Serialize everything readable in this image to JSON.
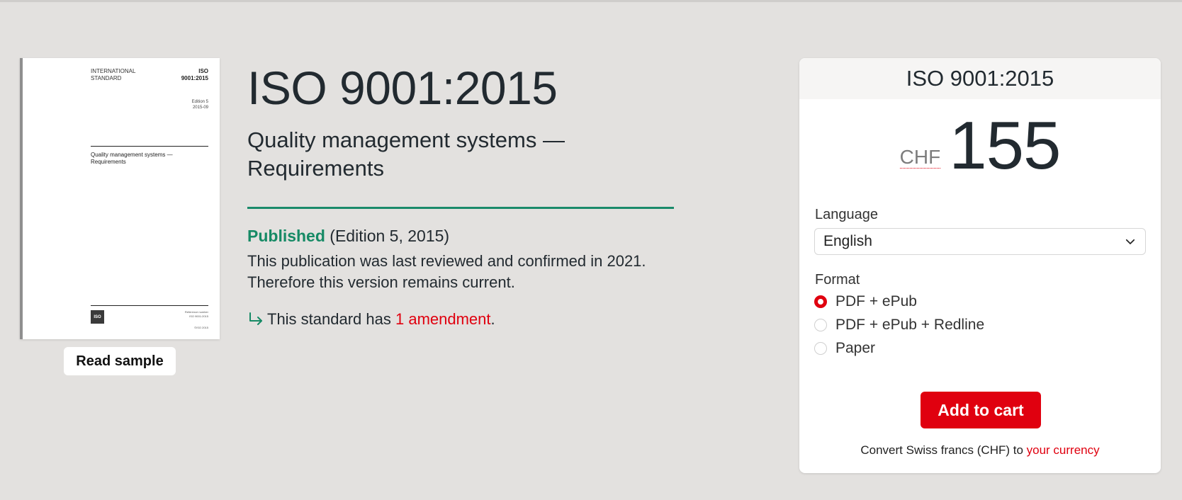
{
  "cover": {
    "intl_standard": "INTERNATIONAL STANDARD",
    "code_line1": "ISO",
    "code_line2": "9001:2015",
    "edition_line1": "Edition 5",
    "edition_line2": "2015-09",
    "title_line1": "Quality management systems —",
    "title_line2": "Requirements",
    "logo_text": "ISO",
    "ref_line1": "Reference number",
    "ref_line2": "ISO 9001:2015",
    "copyright": "©ISO 2015"
  },
  "read_sample_label": "Read sample",
  "standard": {
    "title": "ISO 9001:2015",
    "subtitle": "Quality management systems — Requirements",
    "status": "Published",
    "edition": "(Edition 5, 2015)",
    "review_text": "This publication was last reviewed and confirmed in 2021. Therefore this version remains current.",
    "amend_prefix": "This standard has ",
    "amend_link": "1 amendment",
    "amend_suffix": "."
  },
  "purchase": {
    "title": "ISO 9001:2015",
    "currency": "CHF",
    "price": "155",
    "language_label": "Language",
    "language_value": "English",
    "format_label": "Format",
    "formats": [
      "PDF + ePub",
      "PDF + ePub + Redline",
      "Paper"
    ],
    "selected_format_index": 0,
    "add_to_cart": "Add to cart",
    "convert_prefix": "Convert Swiss francs (CHF) to ",
    "convert_link": "your currency"
  },
  "colors": {
    "background": "#e3e1df",
    "accent_red": "#e0000f",
    "published_green": "#168a65",
    "divider_green": "#1a8a6a",
    "text": "#222a30"
  }
}
